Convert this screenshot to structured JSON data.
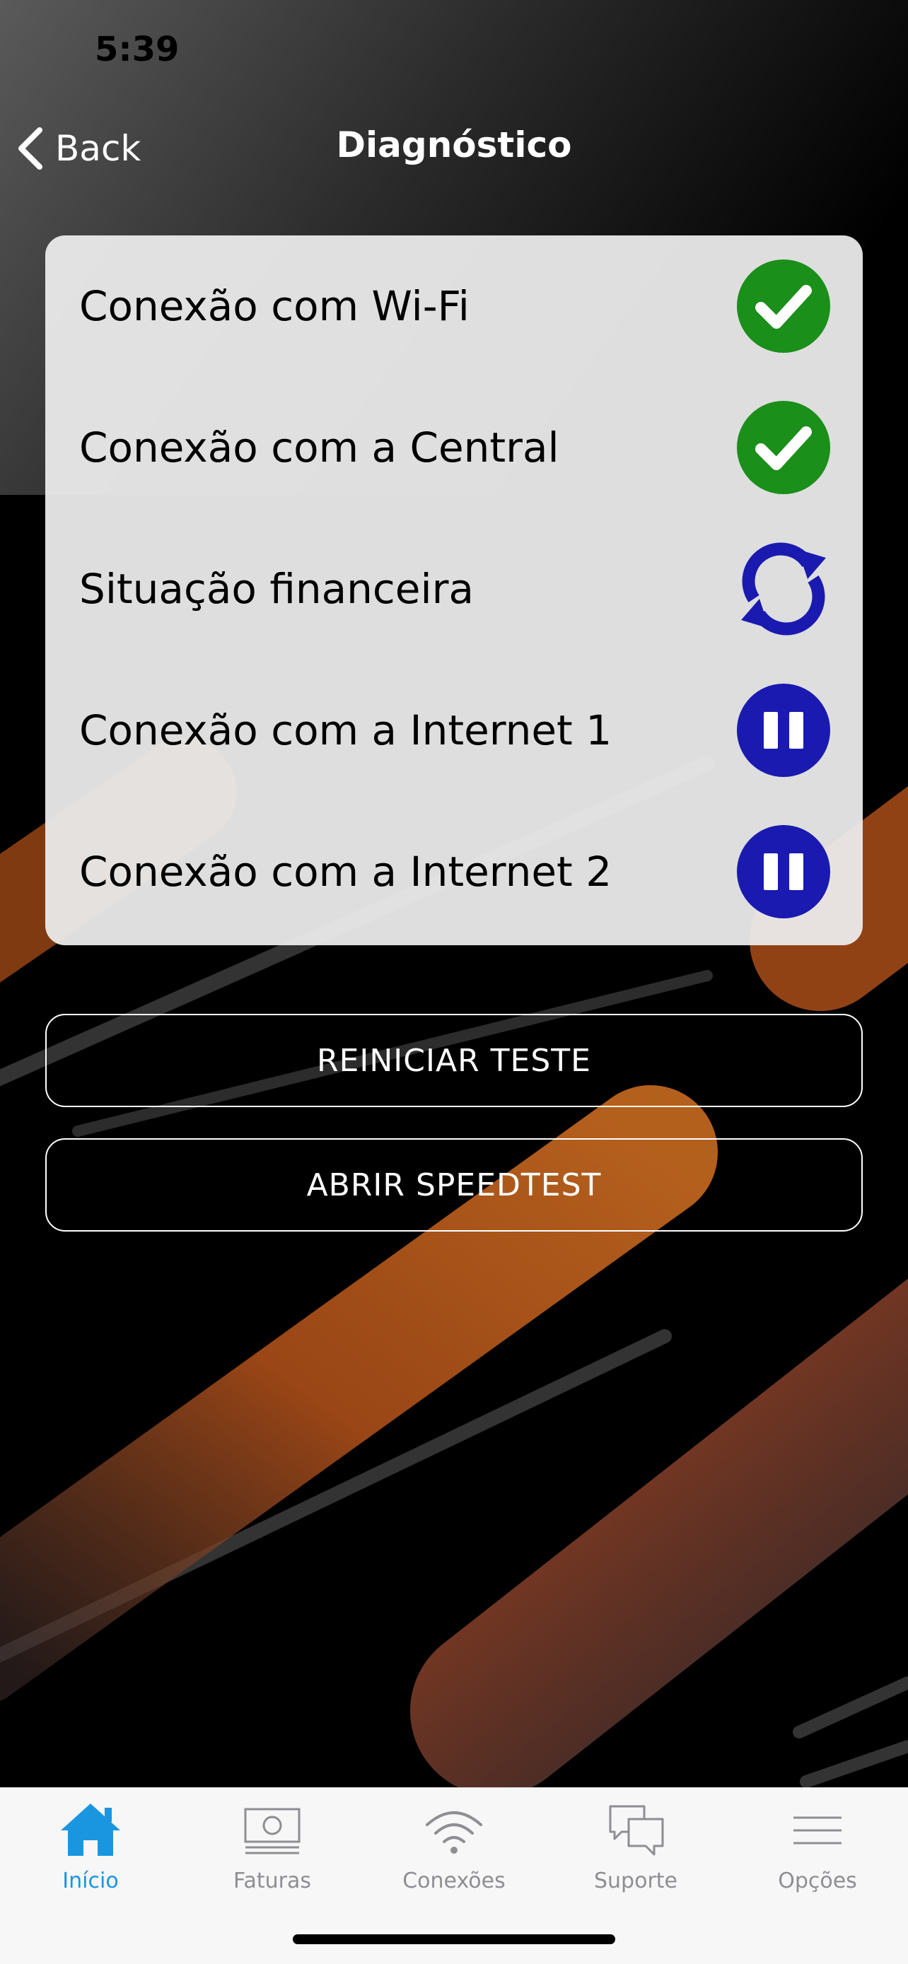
{
  "status_bar": {
    "time": "5:39"
  },
  "nav": {
    "back_label": "Back",
    "title": "Diagnóstico"
  },
  "diagnostics": {
    "items": [
      {
        "label": "Conexão com Wi-Fi",
        "status_icon": "check-icon"
      },
      {
        "label": "Conexão com a Central",
        "status_icon": "check-icon"
      },
      {
        "label": "Situação financeira",
        "status_icon": "sync-icon"
      },
      {
        "label": "Conexão com a Internet 1",
        "status_icon": "pause-icon"
      },
      {
        "label": "Conexão com a Internet 2",
        "status_icon": "pause-icon"
      }
    ]
  },
  "actions": {
    "restart_label": "REINICIAR TESTE",
    "speedtest_label": "ABRIR SPEEDTEST"
  },
  "tabs": [
    {
      "label": "Início",
      "icon": "home-icon",
      "active": true
    },
    {
      "label": "Faturas",
      "icon": "bill-icon",
      "active": false
    },
    {
      "label": "Conexões",
      "icon": "wifi-icon",
      "active": false
    },
    {
      "label": "Suporte",
      "icon": "chat-icon",
      "active": false
    },
    {
      "label": "Opções",
      "icon": "menu-icon",
      "active": false
    }
  ],
  "colors": {
    "success_green": "#1a8f1a",
    "progress_blue": "#1a1ab0",
    "active_tab": "#1a96e0",
    "inactive_tab": "#8e8e93",
    "accent_orange": "#b5521a"
  }
}
